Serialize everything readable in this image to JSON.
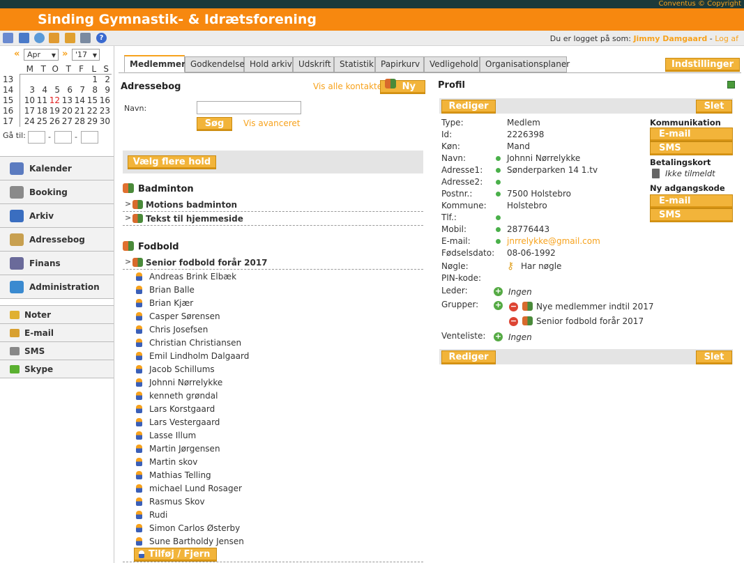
{
  "app": {
    "copyright": "Conventus © Copyright",
    "title": "Sinding Gymnastik- & Idrætsforening",
    "login_prefix": "Du er logget på som:",
    "user": "Jimmy Damgaard",
    "logout": "Log af"
  },
  "toolbar_icons": [
    "calendar-icon",
    "swap-icon",
    "refresh-icon",
    "home-icon",
    "save-icon",
    "computer-icon",
    "help-icon"
  ],
  "calendar": {
    "month": "Apr",
    "year": "'17",
    "weekdays": [
      "M",
      "T",
      "O",
      "T",
      "F",
      "L",
      "S"
    ],
    "weeks": [
      {
        "wk": "13",
        "days": [
          "",
          "",
          "",
          "",
          "",
          "1",
          "2"
        ]
      },
      {
        "wk": "14",
        "days": [
          "3",
          "4",
          "5",
          "6",
          "7",
          "8",
          "9"
        ]
      },
      {
        "wk": "15",
        "days": [
          "10",
          "11",
          "12",
          "13",
          "14",
          "15",
          "16"
        ]
      },
      {
        "wk": "16",
        "days": [
          "17",
          "18",
          "19",
          "20",
          "21",
          "22",
          "23"
        ]
      },
      {
        "wk": "17",
        "days": [
          "24",
          "25",
          "26",
          "27",
          "28",
          "29",
          "30"
        ]
      }
    ],
    "today": "12",
    "goto_label": "Gå til:"
  },
  "nav": {
    "main": [
      {
        "label": "Kalender",
        "icon": "calendar-icon",
        "color": "#5b7bc0"
      },
      {
        "label": "Booking",
        "icon": "wrench-icon",
        "color": "#8a8a8a"
      },
      {
        "label": "Arkiv",
        "icon": "archive-icon",
        "color": "#3a6ec0"
      },
      {
        "label": "Adressebog",
        "icon": "book-icon",
        "color": "#c8a050"
      },
      {
        "label": "Finans",
        "icon": "finance-icon",
        "color": "#6a6a9a"
      },
      {
        "label": "Administration",
        "icon": "admin-icon",
        "color": "#3a8ad0"
      }
    ],
    "secondary": [
      {
        "label": "Noter",
        "icon": "notes-icon",
        "color": "#e0b030"
      },
      {
        "label": "E-mail",
        "icon": "email-icon",
        "color": "#d8a030"
      },
      {
        "label": "SMS",
        "icon": "sms-icon",
        "color": "#888888"
      },
      {
        "label": "Skype",
        "icon": "skype-icon",
        "color": "#5ab030"
      }
    ]
  },
  "tabs": [
    "Medlemmer",
    "Godkendelse",
    "Hold arkiv",
    "Udskrift",
    "Statistik",
    "Papirkurv",
    "Vedligehold",
    "Organisationsplaner"
  ],
  "settings_button": "Indstillinger",
  "addressbook": {
    "title": "Adressebog",
    "show_all": "Vis alle kontakter",
    "new_button": "Ny",
    "name_label": "Navn:",
    "name_value": "",
    "search_button": "Søg",
    "advanced": "Vis avanceret",
    "select_teams": "Vælg flere hold"
  },
  "groups": [
    {
      "title": "Badminton",
      "subs": [
        "Motions badminton",
        "Tekst til hjemmeside"
      ]
    },
    {
      "title": "Fodbold",
      "subs": [
        "Senior fodbold forår 2017"
      ]
    }
  ],
  "members": [
    "Andreas Brink Elbæk",
    "Brian Balle",
    "Brian Kjær",
    "Casper Sørensen",
    "Chris Josefsen",
    "Christian Christiansen",
    "Emil Lindholm Dalgaard",
    "Jacob Schillums",
    "Johnni Nørrelykke",
    "kenneth grøndal",
    "Lars Korstgaard",
    "Lars Vestergaard",
    "Lasse Illum",
    "Martin Jørgensen",
    "Martin skov",
    "Mathias Telling",
    "michael Lund Rosager",
    "Rasmus Skov",
    "Rudi",
    "Simon Carlos Østerby",
    "Sune Bartholdy Jensen"
  ],
  "add_remove": "Tilføj / Fjern",
  "profile": {
    "title": "Profil",
    "edit": "Rediger",
    "delete": "Slet",
    "fields": [
      {
        "k": "Type:",
        "v": "Medlem",
        "dot": false
      },
      {
        "k": "Id:",
        "v": "2226398",
        "dot": false
      },
      {
        "k": "Køn:",
        "v": "Mand",
        "dot": false
      },
      {
        "k": "Navn:",
        "v": "Johnni Nørrelykke",
        "dot": true
      },
      {
        "k": "Adresse1:",
        "v": "Sønderparken 14 1.tv",
        "dot": true
      },
      {
        "k": "Adresse2:",
        "v": "",
        "dot": true
      },
      {
        "k": "Postnr.:",
        "v": "7500 Holstebro",
        "dot": true
      },
      {
        "k": "Kommune:",
        "v": "Holstebro",
        "dot": false
      },
      {
        "k": "Tlf.:",
        "v": "",
        "dot": true
      },
      {
        "k": "Mobil:",
        "v": "28776443",
        "dot": true
      },
      {
        "k": "E-mail:",
        "v": "jnrrelykke@gmail.com",
        "dot": true
      },
      {
        "k": "Fødselsdato:",
        "v": "08-06-1992",
        "dot": false
      }
    ],
    "key_label": "Nøgle:",
    "key_value": "Har nøgle",
    "pin_label": "PIN-kode:",
    "leader_label": "Leder:",
    "leader_value": "Ingen",
    "groups_label": "Grupper:",
    "groups": [
      "Nye medlemmer indtil 2017",
      "Senior fodbold forår 2017"
    ],
    "waitlist_label": "Venteliste:",
    "waitlist_value": "Ingen"
  },
  "communication": {
    "title": "Kommunikation",
    "email": "E-mail",
    "sms": "SMS",
    "card_title": "Betalingskort",
    "card_value": "Ikke tilmeldt",
    "pw_title": "Ny adgangskode",
    "pw_email": "E-mail",
    "pw_sms": "SMS"
  }
}
